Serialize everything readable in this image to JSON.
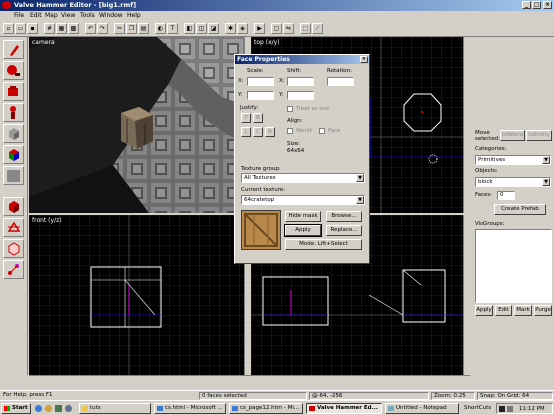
{
  "window": {
    "title": "Valve Hammer Editor - [big1.rmf]"
  },
  "menu": [
    "File",
    "Edit",
    "Map",
    "View",
    "Tools",
    "Window",
    "Help"
  ],
  "viewports": {
    "camera": "camera",
    "top": "top (x/y)",
    "front": "front (y/z)"
  },
  "face_dialog": {
    "title": "Face Properties",
    "scale_label": "Scale:",
    "shift_label": "Shift:",
    "rotation_label": "Rotation:",
    "x_label": "X:",
    "y_label": "Y:",
    "justify_label": "Justify:",
    "justify_buttons": [
      "T",
      "B",
      "L",
      "C",
      "R"
    ],
    "treat_as_one": "Treat as one",
    "align_label": "Align:",
    "world_label": "World",
    "face_label": "Face",
    "size_label": "Size:",
    "size_value": "64x64",
    "texture_group_label": "Texture group:",
    "texture_group_value": "All Textures",
    "current_texture_label": "Current texture:",
    "current_texture_value": "64cratetop",
    "hide_mask": "Hide mask",
    "browse": "Browse...",
    "apply": "Apply",
    "replace": "Replace...",
    "mode": "Mode: Lift+Select"
  },
  "right_panel": {
    "move_selected": "Move selected:",
    "to_world": "toWorld",
    "to_entity": "toEntity",
    "categories_label": "Categories:",
    "categories_value": "Primitives",
    "objects_label": "Objects:",
    "objects_value": "block",
    "faces_label": "Faces:",
    "faces_value": "0",
    "create_prefab": "Create Prefab",
    "visgroups_label": "VisGroups:",
    "apply": "Apply",
    "edit": "Edit",
    "mark": "Mark",
    "purge": "Purge"
  },
  "status": {
    "help": "For Help, press F1",
    "selection": "0 faces selected",
    "coords": "@-64, -256",
    "zoom": "Zoom: 0.25",
    "snap": "Snap: On Grid: 64"
  },
  "taskbar": {
    "start": "Start",
    "tasks": [
      "tuts",
      "cs.html - Microsoft ...",
      "cs_page12.htm - Mi...",
      "Valve Hammer Ed...",
      "Untitled - Notepad"
    ],
    "shortcuts": "ShortCuts",
    "clock": "11:12 PM"
  },
  "colors": {
    "title_start": "#0a246a",
    "title_end": "#a6caf0",
    "grid": "#3b3b3b",
    "grid_major": "#5a5a5a",
    "geometry": "#ffffff",
    "accent_blue": "#0000ff",
    "accent_pink": "#ff00ff"
  }
}
